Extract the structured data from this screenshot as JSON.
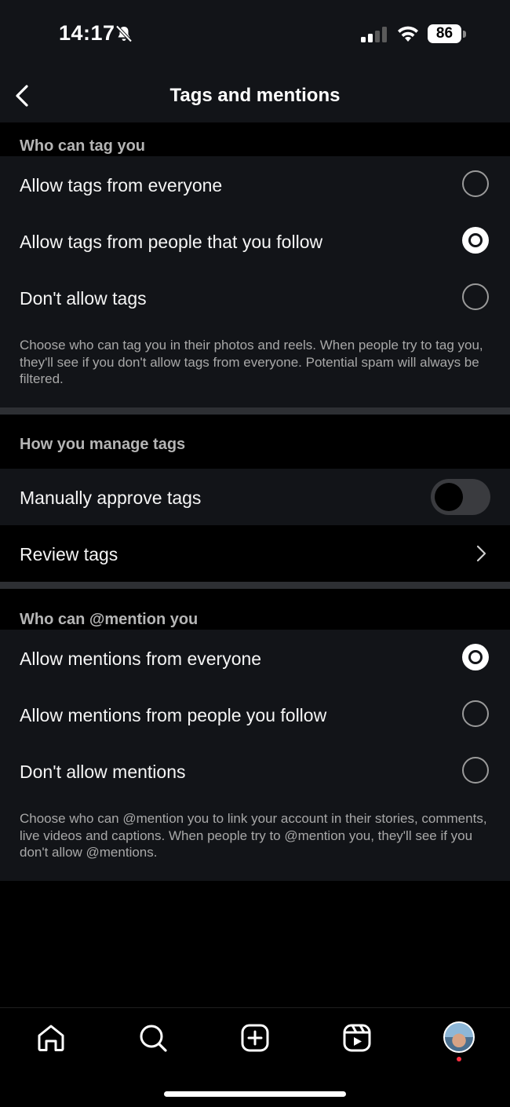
{
  "status_bar": {
    "time": "14:17",
    "battery": "86"
  },
  "header": {
    "title": "Tags and mentions"
  },
  "tags_section": {
    "title": "Who can tag you",
    "options": [
      {
        "label": "Allow tags from everyone",
        "selected": false
      },
      {
        "label": "Allow tags from people that you follow",
        "selected": true
      },
      {
        "label": "Don't allow tags",
        "selected": false
      }
    ],
    "description": "Choose who can tag you in their photos and reels. When people try to tag you, they'll see if you don't allow tags from everyone. Potential spam will always be filtered."
  },
  "manage_section": {
    "title": "How you manage tags",
    "manual_approve_label": "Manually approve tags",
    "manual_approve_on": false,
    "review_label": "Review tags"
  },
  "mentions_section": {
    "title": "Who can @mention you",
    "options": [
      {
        "label": "Allow mentions from everyone",
        "selected": true
      },
      {
        "label": "Allow mentions from people you follow",
        "selected": false
      },
      {
        "label": "Don't allow mentions",
        "selected": false
      }
    ],
    "description": "Choose who can @mention you to link your account in their stories, comments, live videos and captions. When people try to @mention you, they'll see if you don't allow @mentions."
  },
  "tab_bar": {
    "items": [
      "home-icon",
      "search-icon",
      "create-icon",
      "reels-icon",
      "profile-avatar"
    ]
  }
}
